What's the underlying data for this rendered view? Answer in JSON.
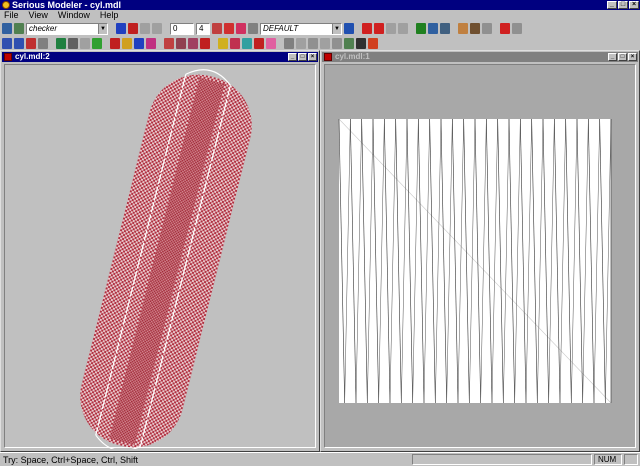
{
  "app": {
    "title": "Serious Modeler - cyl.mdl"
  },
  "window_controls": {
    "minimize": "_",
    "maximize": "□",
    "close": "×"
  },
  "menu": [
    "File",
    "View",
    "Window",
    "Help"
  ],
  "toolbar": {
    "texture_combo": "checker",
    "frame_field": "0",
    "frame_step_field": "4",
    "animation_combo": "DEFAULT"
  },
  "views": {
    "left": {
      "title": "cyl.mdl:2",
      "active": true
    },
    "right": {
      "title": "cyl.mdl:1",
      "active": false
    }
  },
  "status": {
    "message": "Try: Space, Ctrl+Space, Ctrl, Shift",
    "indicator": "NUM"
  },
  "colors": {
    "title_active": "#000080",
    "title_inactive": "#808080",
    "mdi_background": "#808080",
    "checker_red": "#b03040",
    "checker_light": "#e8c8cc",
    "wire": "#ffffff"
  }
}
